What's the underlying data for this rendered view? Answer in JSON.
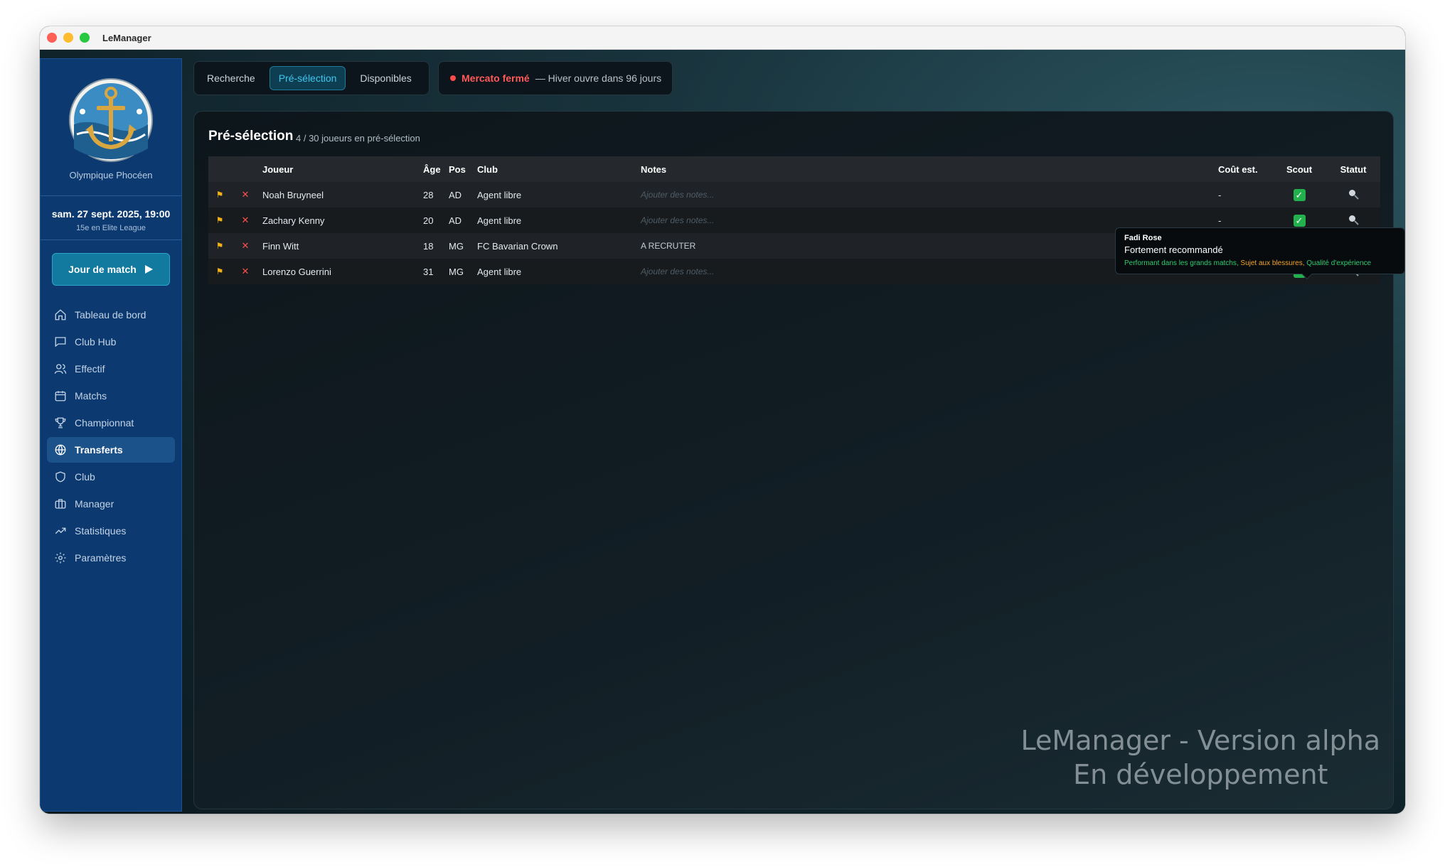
{
  "window": {
    "title": "LeManager"
  },
  "sidebar": {
    "club_name": "Olympique Phocéen",
    "date": "sam. 27 sept. 2025, 19:00",
    "league": "15e en Elite League",
    "matchday_label": "Jour de match",
    "items": [
      {
        "label": "Tableau de bord",
        "icon": "home-icon"
      },
      {
        "label": "Club Hub",
        "icon": "message-icon"
      },
      {
        "label": "Effectif",
        "icon": "users-icon"
      },
      {
        "label": "Matchs",
        "icon": "calendar-icon"
      },
      {
        "label": "Championnat",
        "icon": "trophy-icon"
      },
      {
        "label": "Transferts",
        "icon": "globe-icon",
        "active": true
      },
      {
        "label": "Club",
        "icon": "shield-icon"
      },
      {
        "label": "Manager",
        "icon": "briefcase-icon"
      },
      {
        "label": "Statistiques",
        "icon": "trend-icon"
      },
      {
        "label": "Paramètres",
        "icon": "gear-icon"
      }
    ]
  },
  "tabs": [
    {
      "label": "Recherche"
    },
    {
      "label": "Pré-sélection",
      "active": true
    },
    {
      "label": "Disponibles"
    }
  ],
  "mercato": {
    "status": "Mercato fermé",
    "info": "— Hiver ouvre dans 96 jours"
  },
  "panel": {
    "title": "Pré-sélection",
    "subtitle": "4 / 30 joueurs en pré-sélection"
  },
  "table": {
    "headers": {
      "player": "Joueur",
      "age": "Âge",
      "pos": "Pos",
      "club": "Club",
      "notes": "Notes",
      "cost": "Coût est.",
      "scout": "Scout",
      "status": "Statut"
    },
    "rows": [
      {
        "player": "Noah Bruyneel",
        "age": "28",
        "pos": "AD",
        "club": "Agent libre",
        "notes": "",
        "notes_placeholder": "Ajouter des notes...",
        "cost": "-",
        "scout": "✓"
      },
      {
        "player": "Zachary Kenny",
        "age": "20",
        "pos": "AD",
        "club": "Agent libre",
        "notes": "",
        "notes_placeholder": "Ajouter des notes...",
        "cost": "-",
        "scout": "✓"
      },
      {
        "player": "Finn Witt",
        "age": "18",
        "pos": "MG",
        "club": "FC Bavarian Crown",
        "notes": "A RECRUTER",
        "notes_placeholder": "Ajouter des notes...",
        "cost": "-",
        "scout": "✓"
      },
      {
        "player": "Lorenzo Guerrini",
        "age": "31",
        "pos": "MG",
        "club": "Agent libre",
        "notes": "",
        "notes_placeholder": "Ajouter des notes...",
        "cost": "-",
        "scout": "✓"
      }
    ]
  },
  "tooltip": {
    "name": "Fadi Rose",
    "recommendation": "Fortement recommandé",
    "tags": [
      {
        "text": "Performant dans les grands matchs,",
        "color": "#2ecc71"
      },
      {
        "text": "Sujet aux blessures,",
        "color": "#f5a623"
      },
      {
        "text": "Qualité d'expérience",
        "color": "#2ecc71"
      }
    ]
  },
  "watermark": {
    "line1": "LeManager - Version alpha",
    "line2": "En développement"
  },
  "colors": {
    "accent": "#3fc7ef",
    "sidebar": "#0c3a70",
    "alert": "#ff5a5a",
    "flag": "#f2b019"
  }
}
